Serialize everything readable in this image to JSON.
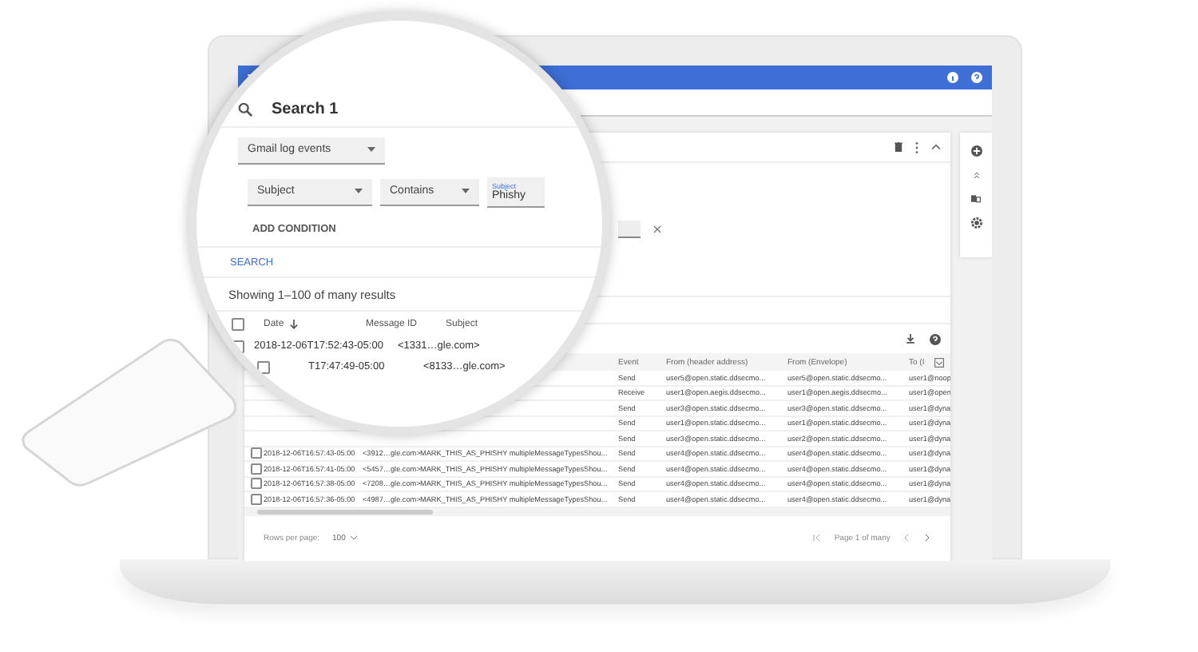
{
  "search": {
    "title": "Search 1",
    "source": "Gmail log events",
    "conditions": [
      {
        "field": "Subject",
        "operator": "Contains",
        "value_label": "Subject",
        "value": "Phishy"
      }
    ],
    "add_condition": "ADD CONDITION",
    "search_button": "SEARCH"
  },
  "results": {
    "summary": "Showing 1–100 of many results",
    "all_selected": false,
    "columns": [
      {
        "label": "Date",
        "sorted": true
      },
      {
        "label": "Message ID",
        "sorted": false
      },
      {
        "label": "Subject",
        "sorted": false
      },
      {
        "label": "Event",
        "sorted": false
      },
      {
        "label": "From (header address)",
        "sorted": false
      },
      {
        "label": "From (Envelope)",
        "sorted": false
      },
      {
        "label": "To (I",
        "sorted": false
      }
    ],
    "magnified_rows": [
      {
        "checked": false,
        "date": "2018-12-06T17:52:43-05:00",
        "message_id": "<1331…gle.com>"
      },
      {
        "checked": false,
        "date": "T17:47:49-05:00",
        "message_id": "<8133…gle.com>"
      }
    ],
    "rows": [
      {
        "event": "Send",
        "from_header": "user5@open.static.ddsecmo...",
        "from_envelope": "user5@open.static.ddsecmo...",
        "to": "user1@noop"
      },
      {
        "event": "Receive",
        "from_header": "user1@open.aegis.ddsecmo...",
        "from_envelope": "user1@open.aegis.ddsecmo...",
        "to": "user1@open"
      },
      {
        "event": "Send",
        "from_header": "user3@open.static.ddsecmo...",
        "from_envelope": "user3@open.static.ddsecmo...",
        "to": "user1@dyna"
      },
      {
        "event": "Send",
        "from_header": "user1@open.static.ddsecmo...",
        "from_envelope": "user1@open.static.ddsecmo...",
        "to": "user1@dyna"
      },
      {
        "event": "Send",
        "from_header": "user3@open.static.ddsecmo...",
        "from_envelope": "user2@open.static.ddsecmo...",
        "to": "user1@dyna"
      },
      {
        "checked": false,
        "date": "2018-12-06T16:57:43-05:00",
        "message_id": "<3912…gle.com>",
        "subject": "MARK_THIS_AS_PHISHY multipleMessageTypesShou...",
        "event": "Send",
        "from_header": "user4@open.static.ddsecmo...",
        "from_envelope": "user4@open.static.ddsecmo...",
        "to": "user1@dyna"
      },
      {
        "checked": false,
        "date": "2018-12-06T16:57:41-05:00",
        "message_id": "<5457…gle.com>",
        "subject": "MARK_THIS_AS_PHISHY multipleMessageTypesShou...",
        "event": "Send",
        "from_header": "user4@open.static.ddsecmo...",
        "from_envelope": "user4@open.static.ddsecmo...",
        "to": "user1@dyna"
      },
      {
        "checked": false,
        "date": "2018-12-06T16:57:38-05:00",
        "message_id": "<7208…gle.com>",
        "subject": "MARK_THIS_AS_PHISHY multipleMessageTypesShou...",
        "event": "Send",
        "from_header": "user4@open.static.ddsecmo...",
        "from_envelope": "user4@open.static.ddsecmo...",
        "to": "user1@dyna"
      },
      {
        "checked": false,
        "date": "2018-12-06T16:57:36-05:00",
        "message_id": "<4987…gle.com>",
        "subject": "MARK_THIS_AS_PHISHY multipleMessageTypesShou...",
        "event": "Send",
        "from_header": "user4@open.static.ddsecmo...",
        "from_envelope": "user4@open.static.ddsecmo...",
        "to": "user1@dyna"
      }
    ]
  },
  "footer": {
    "rows_per_page_label": "Rows per page:",
    "rows_per_page": "100",
    "page": "Page 1 of many"
  }
}
